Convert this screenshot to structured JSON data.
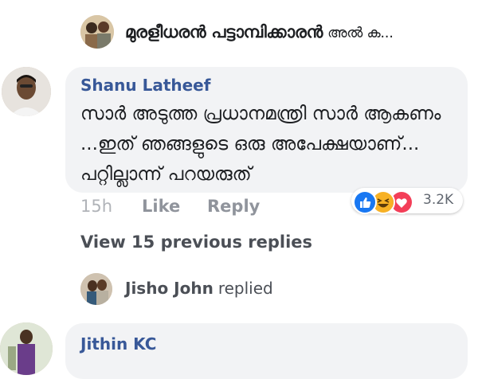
{
  "top_reply": {
    "name": "മുരളീധരൻ പട്ടാമ്പിക്കാരൻ",
    "suffix": "അൽ ക..."
  },
  "comment": {
    "author": "Shanu Latheef",
    "text": "സാർ അടുത്ത പ്രധാനമന്ത്രി സാർ ആകണം ...ഇത് ഞങ്ങളുടെ ഒരു അപേക്ഷയാണ്... പറ്റില്ലാന്ന് പറയരുത്",
    "time": "15h",
    "like_label": "Like",
    "reply_label": "Reply",
    "reactions": {
      "icons": [
        "like-icon",
        "haha-icon",
        "love-icon"
      ],
      "count": "3.2K"
    }
  },
  "view_previous_label": "View 15 previous replies",
  "replier": {
    "name": "Jisho John",
    "verb": "replied"
  },
  "next_comment": {
    "author": "Jithin KC"
  },
  "colors": {
    "name_link": "#385898",
    "bubble": "#f2f3f5",
    "meta": "#90949c",
    "like_blue": "#1877f2",
    "love_red": "#f33e58",
    "haha_yellow": "#f7b125"
  }
}
